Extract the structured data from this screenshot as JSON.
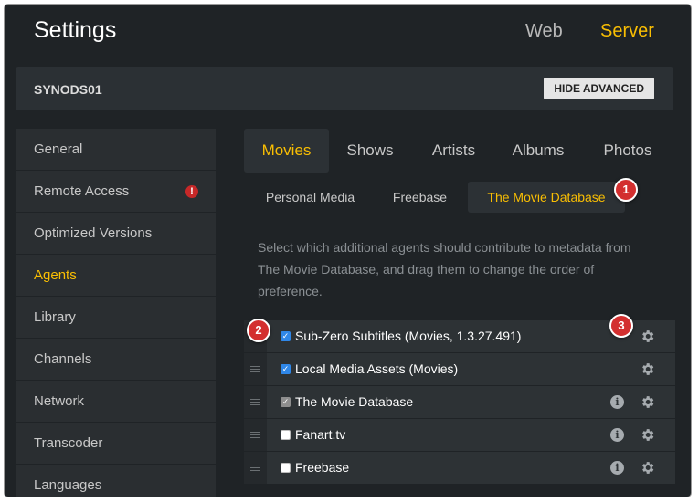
{
  "header": {
    "title": "Settings",
    "tabs": [
      {
        "label": "Web",
        "active": false
      },
      {
        "label": "Server",
        "active": true
      }
    ]
  },
  "server_bar": {
    "name": "SYNODS01",
    "hide_advanced_label": "HIDE ADVANCED"
  },
  "sidebar": {
    "items": [
      {
        "label": "General",
        "active": false
      },
      {
        "label": "Remote Access",
        "active": false,
        "warning": "!"
      },
      {
        "label": "Optimized Versions",
        "active": false
      },
      {
        "label": "Agents",
        "active": true
      },
      {
        "label": "Library",
        "active": false
      },
      {
        "label": "Channels",
        "active": false
      },
      {
        "label": "Network",
        "active": false
      },
      {
        "label": "Transcoder",
        "active": false
      },
      {
        "label": "Languages",
        "active": false
      }
    ]
  },
  "media_tabs": [
    {
      "label": "Movies",
      "active": true
    },
    {
      "label": "Shows",
      "active": false
    },
    {
      "label": "Artists",
      "active": false
    },
    {
      "label": "Albums",
      "active": false
    },
    {
      "label": "Photos",
      "active": false
    }
  ],
  "agent_tabs": [
    {
      "label": "Personal Media",
      "active": false
    },
    {
      "label": "Freebase",
      "active": false
    },
    {
      "label": "The Movie Database",
      "active": true
    }
  ],
  "description_lines": [
    "Select which additional agents should contribute to metadata from",
    "The Movie Database, and drag them to change the order of",
    "preference."
  ],
  "agents": [
    {
      "label": "Sub-Zero Subtitles (Movies, 1.3.27.491)",
      "state": "checked"
    },
    {
      "label": "Local Media Assets (Movies)",
      "state": "checked"
    },
    {
      "label": "The Movie Database",
      "state": "disabled-checked"
    },
    {
      "label": "Fanart.tv",
      "state": "unchecked"
    },
    {
      "label": "Freebase",
      "state": "unchecked"
    }
  ],
  "annotations": [
    "1",
    "2",
    "3"
  ],
  "colors": {
    "accent": "#f9be03",
    "background": "#1f2326",
    "panel": "#2b3034",
    "checkbox": "#2f87e8",
    "badge": "#d32f2f"
  }
}
